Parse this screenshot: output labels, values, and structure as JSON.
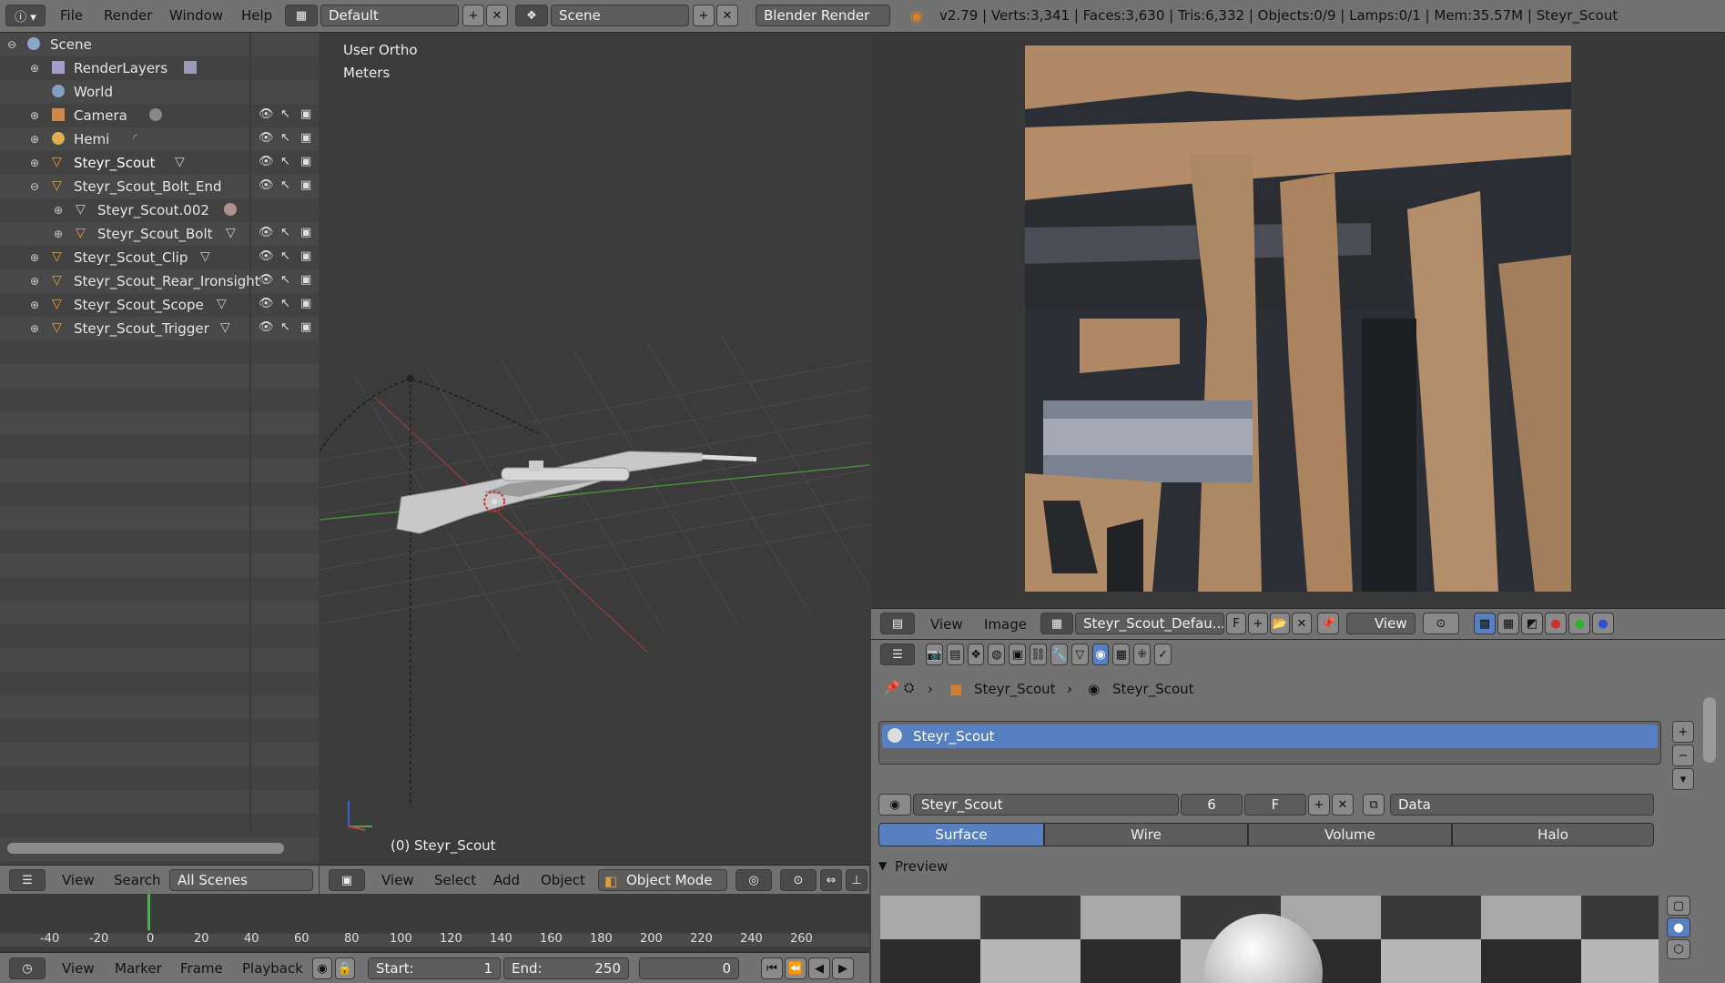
{
  "topbar": {
    "menu": [
      "File",
      "Render",
      "Window",
      "Help"
    ],
    "layout": "Default",
    "scene": "Scene",
    "engine": "Blender Render",
    "stats": "v2.79 | Verts:3,341 | Faces:3,630 | Tris:6,332 | Objects:0/9 | Lamps:0/1 | Mem:35.57M | Steyr_Scout"
  },
  "outliner": {
    "items": [
      {
        "label": "Scene",
        "icon": "scene-icon"
      },
      {
        "label": "RenderLayers",
        "icon": "render-layers-icon"
      },
      {
        "label": "World",
        "icon": "world-icon"
      },
      {
        "label": "Camera",
        "icon": "camera-icon"
      },
      {
        "label": "Hemi",
        "icon": "lamp-icon"
      },
      {
        "label": "Steyr_Scout",
        "icon": "mesh-object-icon"
      },
      {
        "label": "Steyr_Scout_Bolt_End",
        "icon": "mesh-object-icon"
      },
      {
        "label": "Steyr_Scout.002",
        "icon": "mesh-data-icon"
      },
      {
        "label": "Steyr_Scout_Bolt",
        "icon": "mesh-object-icon"
      },
      {
        "label": "Steyr_Scout_Clip",
        "icon": "mesh-object-icon"
      },
      {
        "label": "Steyr_Scout_Rear_Ironsight",
        "icon": "mesh-object-icon"
      },
      {
        "label": "Steyr_Scout_Scope",
        "icon": "mesh-object-icon"
      },
      {
        "label": "Steyr_Scout_Trigger",
        "icon": "mesh-object-icon"
      }
    ],
    "footer": {
      "view": "View",
      "search": "Search",
      "scenes": "All Scenes"
    }
  },
  "viewport": {
    "view_name": "User Ortho",
    "units": "Meters",
    "object_label": "(0) Steyr_Scout",
    "menu": [
      "View",
      "Select",
      "Add",
      "Object"
    ],
    "mode": "Object Mode"
  },
  "image_editor": {
    "menu": [
      "View",
      "Image"
    ],
    "image_name": "Steyr_Scout_Defau...",
    "fake_user": "F",
    "view": "View"
  },
  "properties": {
    "breadcrumb": [
      "Steyr_Scout",
      "Steyr_Scout"
    ],
    "material_slot": "Steyr_Scout",
    "material_name": "Steyr_Scout",
    "users": "6",
    "fake": "F",
    "link": "Data",
    "tabs": [
      "Surface",
      "Wire",
      "Volume",
      "Halo"
    ],
    "preview_label": "Preview"
  },
  "timeline": {
    "ticks": [
      "-40",
      "-20",
      "0",
      "20",
      "40",
      "60",
      "80",
      "100",
      "120",
      "140",
      "160",
      "180",
      "200",
      "220",
      "240",
      "260"
    ],
    "menu": [
      "View",
      "Marker",
      "Frame",
      "Playback"
    ],
    "start_label": "Start:",
    "start": "1",
    "end_label": "End:",
    "end": "250",
    "current": "0"
  }
}
